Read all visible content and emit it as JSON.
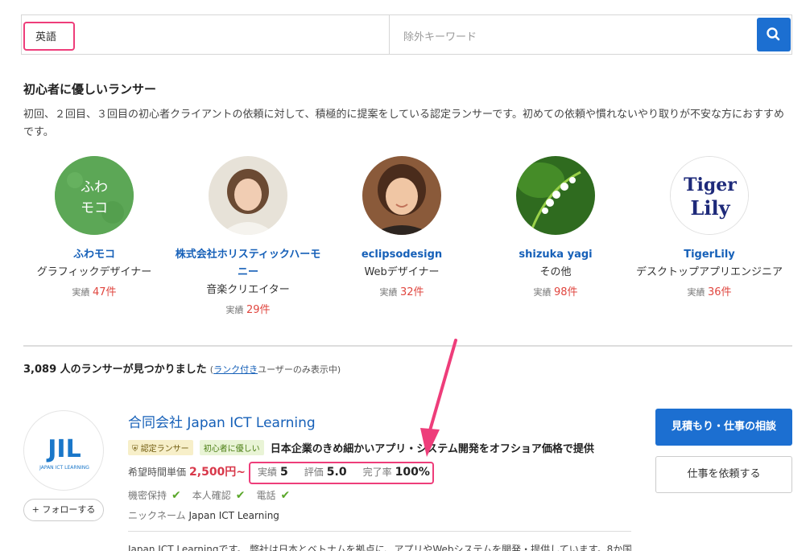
{
  "search": {
    "keyword": "英語",
    "exclude_placeholder": "除外キーワード",
    "button_icon": "search-icon"
  },
  "beginner": {
    "title": "初心者に優しいランサー",
    "description": "初回、２回目、３回目の初心者クライアントの依頼に対して、積極的に提案をしている認定ランサーです。初めての依頼や慣れないやり取りが不安な方におすすめです。",
    "lancers": [
      {
        "name": "ふわモコ",
        "job": "グラフィックデザイナー",
        "record_label": "実績",
        "record": "47件",
        "avatar_text": "ふわ\nモコ"
      },
      {
        "name": "株式会社ホリスティックハーモニー",
        "job": "音楽クリエイター",
        "record_label": "実績",
        "record": "29件"
      },
      {
        "name": "eclipsodesign",
        "job": "Webデザイナー",
        "record_label": "実績",
        "record": "32件"
      },
      {
        "name": "shizuka yagi",
        "job": "その他",
        "record_label": "実績",
        "record": "98件"
      },
      {
        "name": "TigerLily",
        "job": "デスクトップアプリエンジニア",
        "record_label": "実績",
        "record": "36件",
        "avatar_text": "Tiger\nLily"
      }
    ]
  },
  "results": {
    "count": "3,089",
    "count_suffix": " 人のランサーが見つかりました",
    "note_open": "(",
    "note_link": "ランク付き",
    "note_rest": "ユーザーのみ表示中)"
  },
  "result": {
    "name": "合同会社 Japan ICT Learning",
    "logo_big": "JIL",
    "logo_small": "JAPAN ICT LEARNING",
    "badge_cert": "認定ランサー",
    "badge_beginner": "初心者に優しい",
    "catch": "日本企業のきめ細かいアプリ・システム開発をオフショア価格で提供",
    "price_label": "希望時間単価",
    "price": "2,500円~",
    "stats": [
      {
        "label": "実績",
        "value": "5"
      },
      {
        "label": "評価",
        "value": "5.0"
      },
      {
        "label": "完了率",
        "value": "100%"
      }
    ],
    "checks": [
      "機密保持",
      "本人確認",
      "電話"
    ],
    "nickname_label": "ニックネーム",
    "nickname": "Japan ICT Learning",
    "follow": "+ フォローする",
    "consult_button": "見積もり・仕事の相談",
    "request_button": "仕事を依頼する",
    "description": "Japan ICT Learningです。 弊社は日本とベトナムを拠点に、アプリやWebシステムを開発・提供しています。8か国"
  },
  "colors": {
    "accent": "#1c6fd1",
    "highlight": "#ee3d7a",
    "price": "#d8384a",
    "record": "#e0463f",
    "check": "#5aa72a"
  }
}
